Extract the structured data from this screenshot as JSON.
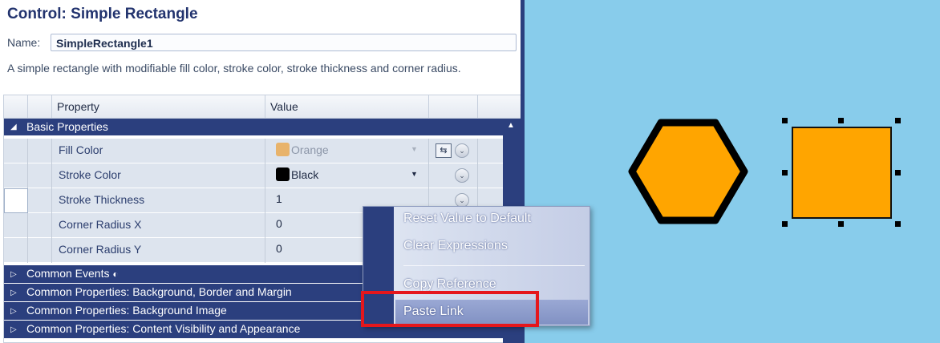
{
  "panel": {
    "title": "Control: Simple Rectangle",
    "name_label": "Name:",
    "name_value": "SimpleRectangle1",
    "description": "A simple rectangle with modifiable fill color, stroke color, stroke thickness and corner radius."
  },
  "grid": {
    "headers": {
      "property": "Property",
      "value": "Value"
    },
    "basic_category": "Basic Properties",
    "rows": [
      {
        "name": "Fill Color",
        "value": "Orange",
        "swatch": "#e8b36b",
        "dimmed": true
      },
      {
        "name": "Stroke Color",
        "value": "Black",
        "swatch": "#000000"
      },
      {
        "name": "Stroke Thickness",
        "value": "1"
      },
      {
        "name": "Corner Radius X",
        "value": "0"
      },
      {
        "name": "Corner Radius Y",
        "value": "0"
      }
    ],
    "categories": [
      "Common Events",
      "Common Properties: Background, Border and Margin",
      "Common Properties: Background Image",
      "Common Properties: Content Visibility and Appearance"
    ]
  },
  "context_menu": {
    "items": [
      "Reset Value to Default",
      "Clear Expressions",
      "Copy Reference",
      "Paste Link"
    ],
    "highlighted": "Paste Link"
  },
  "icons": {
    "collapse": "triangle-down-icon",
    "expand": "triangle-right-icon",
    "dropdown": "chevron-down-icon",
    "link": "link-icon",
    "info": "info-icon"
  },
  "colors": {
    "accent": "#2b3f7e",
    "canvas_bg": "#88cceb",
    "shape_fill": "#ffa500",
    "highlight_box": "#e5171c"
  }
}
